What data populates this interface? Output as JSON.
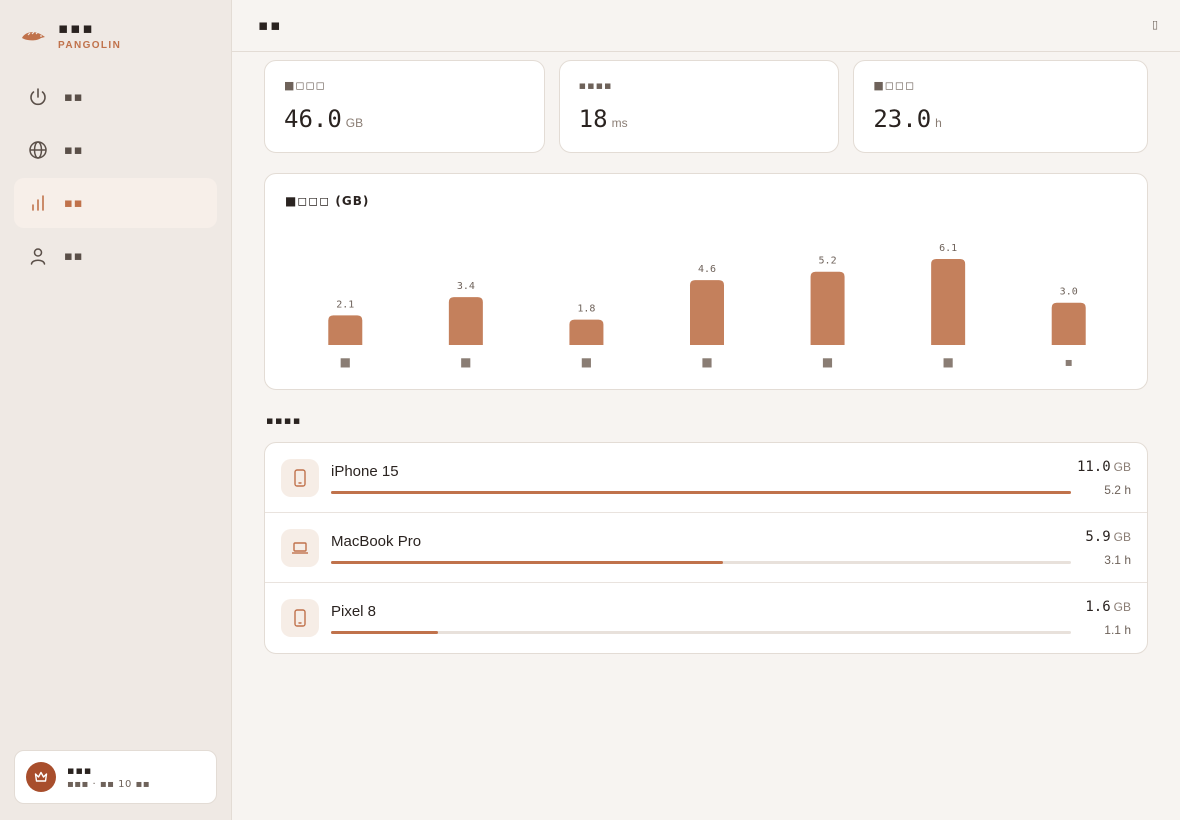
{
  "brand": {
    "title": "▪▪▪",
    "subtitle": "PANGOLIN"
  },
  "nav": [
    {
      "label": "▪▪",
      "icon": "power-icon",
      "active": false
    },
    {
      "label": "▪▪",
      "icon": "globe-icon",
      "active": false
    },
    {
      "label": "▪▪",
      "icon": "bar-chart-icon",
      "active": true
    },
    {
      "label": "▪▪",
      "icon": "user-icon",
      "active": false
    }
  ],
  "account": {
    "name": "▪▪▪",
    "subtitle": "▪▪▪ · ▪▪ 10 ▪▪",
    "icon": "crown-icon"
  },
  "header": {
    "title": "▪▪",
    "icon_label": "▯"
  },
  "stats": [
    {
      "label": "■◻◻◻",
      "value": "46.0",
      "unit": "GB"
    },
    {
      "label": "▪▪▪▪",
      "value": "18",
      "unit": "ms"
    },
    {
      "label": "■◻◻◻",
      "value": "23.0",
      "unit": "h"
    }
  ],
  "chart_data": {
    "type": "bar",
    "title": "■◻◻◻ (GB)",
    "categories": [
      "■",
      "■",
      "■",
      "■",
      "■",
      "■",
      "▪"
    ],
    "values": [
      2.1,
      3.4,
      1.8,
      4.6,
      5.2,
      6.1,
      3.0
    ],
    "value_labels": [
      "2.1",
      "3.4",
      "1.8",
      "4.6",
      "5.2",
      "6.1",
      "3.0"
    ],
    "ylim": [
      0,
      6.1
    ],
    "color": "#c4805c",
    "grid": false
  },
  "devices_section": {
    "title": "▪▪▪▪"
  },
  "devices": [
    {
      "name": "iPhone 15",
      "data": "11.0",
      "unit": "GB",
      "time": "5.2 h",
      "share": 1.0,
      "icon": "phone-icon"
    },
    {
      "name": "MacBook Pro",
      "data": "5.9",
      "unit": "GB",
      "time": "3.1 h",
      "share": 0.53,
      "icon": "laptop-icon"
    },
    {
      "name": "Pixel 8",
      "data": "1.6",
      "unit": "GB",
      "time": "1.1 h",
      "share": 0.145,
      "icon": "phone-icon"
    }
  ],
  "colors": {
    "accent": "#c0724b",
    "bar": "#c4805c",
    "avatar": "#a84e2c"
  }
}
